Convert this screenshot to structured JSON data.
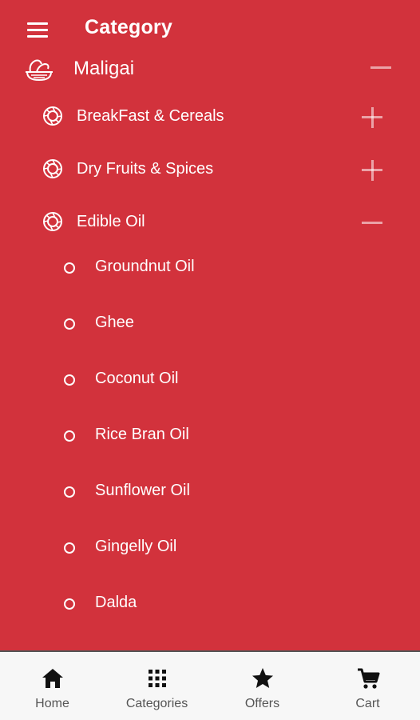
{
  "header": {
    "title": "Category",
    "menu_icon": "hamburger-menu-icon"
  },
  "category": {
    "label": "Maligai",
    "icon": "grocery-basket-icon",
    "expanded": true
  },
  "subcategories": [
    {
      "label": "BreakFast & Cereals",
      "expanded": false
    },
    {
      "label": "Dry Fruits & Spices",
      "expanded": false
    },
    {
      "label": "Edible Oil",
      "expanded": true
    }
  ],
  "edible_oil_items": [
    "Groundnut Oil",
    "Ghee",
    "Coconut Oil",
    "Rice Bran Oil",
    "Sunflower Oil",
    "Gingelly Oil",
    "Dalda"
  ],
  "bottom_nav": [
    {
      "label": "Home",
      "icon": "home-icon"
    },
    {
      "label": "Categories",
      "icon": "grid-icon"
    },
    {
      "label": "Offers",
      "icon": "star-icon"
    },
    {
      "label": "Cart",
      "icon": "cart-icon"
    }
  ],
  "colors": {
    "background": "#d2323c",
    "nav_background": "#f7f7f7",
    "nav_text": "#555555"
  }
}
